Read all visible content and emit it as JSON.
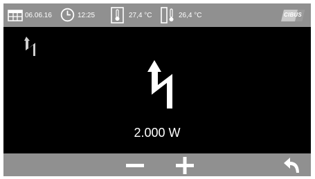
{
  "status_bar": {
    "date": "06.06.16",
    "time": "12:25",
    "outdoor_temp": "27,4 °C",
    "indoor_temp": "26,4 °C",
    "logo_text": "CIBUS",
    "icons": [
      "calendar-icon",
      "clock-icon",
      "outdoor-thermometer-icon",
      "indoor-thermometer-icon"
    ]
  },
  "main": {
    "mode_icon": "lightning-icon",
    "power_value": "2.000 W"
  },
  "bottom_bar": {
    "buttons": [
      "minus-button",
      "plus-button",
      "back-button"
    ]
  },
  "colors": {
    "bar": "#909090",
    "background": "#000000",
    "foreground": "#ffffff",
    "logo": "#c9c9c9"
  }
}
